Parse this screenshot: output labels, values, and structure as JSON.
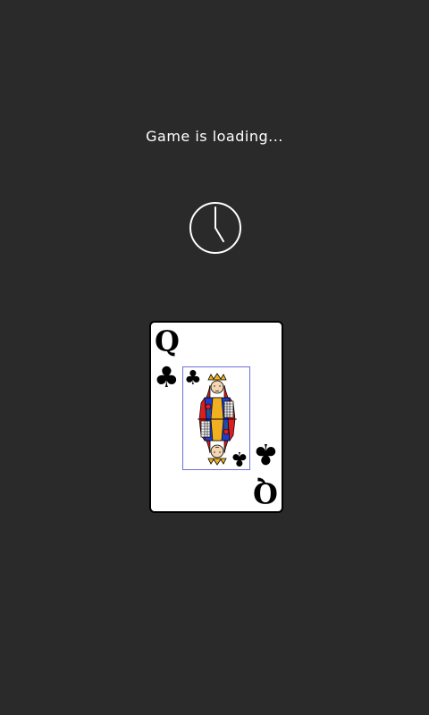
{
  "status": {
    "loading_text": "Game is loading..."
  },
  "loader": {
    "icon": "clock-icon"
  },
  "card": {
    "rank": "Q",
    "suit_symbol": "♣",
    "suit": "clubs",
    "face": "queen-portrait"
  },
  "colors": {
    "background": "#2a2a2a",
    "text": "#ffffff",
    "card": "#ffffff",
    "face_border": "#6f6fd8"
  }
}
